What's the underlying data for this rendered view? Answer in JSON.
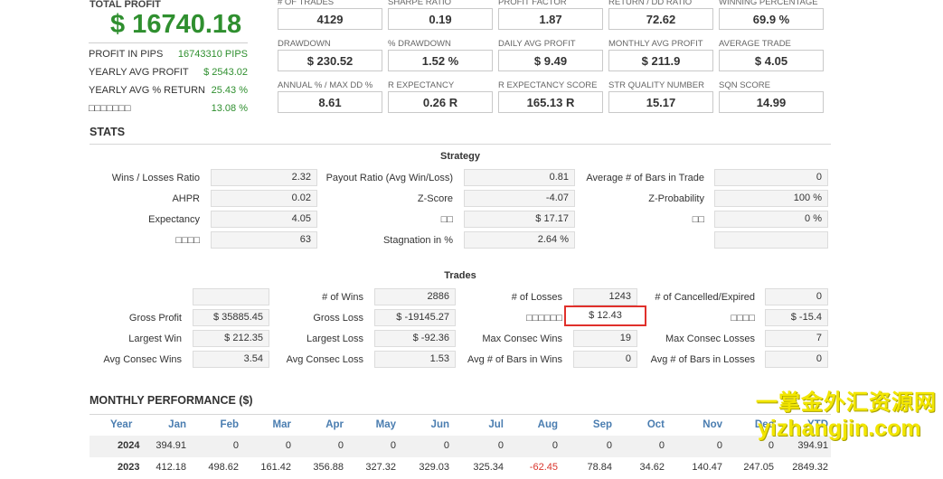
{
  "summary": {
    "total_profit_label": "TOTAL PROFIT",
    "total_profit_value": "$ 16740.18",
    "rows": [
      {
        "label": "PROFIT IN PIPS",
        "value": "16743310 PIPS"
      },
      {
        "label": "YEARLY AVG PROFIT",
        "value": "$ 2543.02"
      },
      {
        "label": "YEARLY AVG % RETURN",
        "value": "25.43 %"
      },
      {
        "label": "□□□□□□□",
        "value": "13.08 %"
      }
    ]
  },
  "metrics": [
    {
      "label": "# OF TRADES",
      "value": "4129"
    },
    {
      "label": "SHARPE RATIO",
      "value": "0.19"
    },
    {
      "label": "PROFIT FACTOR",
      "value": "1.87"
    },
    {
      "label": "RETURN / DD RATIO",
      "value": "72.62"
    },
    {
      "label": "WINNING PERCENTAGE",
      "value": "69.9 %"
    },
    {
      "label": "DRAWDOWN",
      "value": "$ 230.52"
    },
    {
      "label": "% DRAWDOWN",
      "value": "1.52 %"
    },
    {
      "label": "DAILY AVG PROFIT",
      "value": "$ 9.49"
    },
    {
      "label": "MONTHLY AVG PROFIT",
      "value": "$ 211.9"
    },
    {
      "label": "AVERAGE TRADE",
      "value": "$ 4.05"
    },
    {
      "label": "ANNUAL % / MAX DD %",
      "value": "8.61"
    },
    {
      "label": "R EXPECTANCY",
      "value": "0.26 R"
    },
    {
      "label": "R EXPECTANCY SCORE",
      "value": "165.13 R"
    },
    {
      "label": "STR QUALITY NUMBER",
      "value": "15.17"
    },
    {
      "label": "SQN SCORE",
      "value": "14.99"
    }
  ],
  "stats": {
    "title": "STATS",
    "strategy_title": "Strategy",
    "strategy_rows": [
      [
        {
          "label": "Wins / Losses Ratio",
          "value": "2.32"
        },
        {
          "label": "Payout Ratio (Avg Win/Loss)",
          "value": "0.81"
        },
        {
          "label": "Average # of Bars in Trade",
          "value": "0"
        }
      ],
      [
        {
          "label": "AHPR",
          "value": "0.02"
        },
        {
          "label": "Z-Score",
          "value": "-4.07"
        },
        {
          "label": "Z-Probability",
          "value": "100 %"
        }
      ],
      [
        {
          "label": "Expectancy",
          "value": "4.05"
        },
        {
          "label": "□□",
          "value": "$ 17.17"
        },
        {
          "label": "□□",
          "value": "0 %"
        }
      ],
      [
        {
          "label": "□□□□",
          "value": "63"
        },
        {
          "label": "Stagnation in %",
          "value": "2.64 %"
        },
        {
          "label": "",
          "value": ""
        }
      ]
    ],
    "trades_title": "Trades",
    "trades_rows": [
      [
        {
          "label": "",
          "value": ""
        },
        {
          "label": "# of Wins",
          "value": "2886"
        },
        {
          "label": "# of Losses",
          "value": "1243"
        },
        {
          "label": "# of Cancelled/Expired",
          "value": "0"
        }
      ],
      [
        {
          "label": "Gross Profit",
          "value": "$ 35885.45"
        },
        {
          "label": "Gross Loss",
          "value": "$ -19145.27"
        },
        {
          "label": "□□□□□□",
          "value": "$ 12.43"
        },
        {
          "label": "□□□□",
          "value": "$ -15.4"
        }
      ],
      [
        {
          "label": "Largest Win",
          "value": "$ 212.35"
        },
        {
          "label": "Largest Loss",
          "value": "$ -92.36"
        },
        {
          "label": "Max Consec Wins",
          "value": "19"
        },
        {
          "label": "Max Consec Losses",
          "value": "7"
        }
      ],
      [
        {
          "label": "Avg Consec Wins",
          "value": "3.54"
        },
        {
          "label": "Avg Consec Loss",
          "value": "1.53"
        },
        {
          "label": "Avg # of Bars in Wins",
          "value": "0"
        },
        {
          "label": "Avg # of Bars in Losses",
          "value": "0"
        }
      ]
    ]
  },
  "monthly": {
    "title": "MONTHLY PERFORMANCE ($)",
    "headers": [
      "Year",
      "Jan",
      "Feb",
      "Mar",
      "Apr",
      "May",
      "Jun",
      "Jul",
      "Aug",
      "Sep",
      "Oct",
      "Nov",
      "Dec",
      "YTD"
    ],
    "rows": [
      [
        "2024",
        "394.91",
        "0",
        "0",
        "0",
        "0",
        "0",
        "0",
        "0",
        "0",
        "0",
        "0",
        "0",
        "394.91"
      ],
      [
        "2023",
        "412.18",
        "498.62",
        "161.42",
        "356.88",
        "327.32",
        "329.03",
        "325.34",
        "-62.45",
        "78.84",
        "34.62",
        "140.47",
        "247.05",
        "2849.32"
      ]
    ]
  },
  "watermark": {
    "line1": "一掌金外汇资源网",
    "line2": "yizhangjin.com"
  },
  "colors": {
    "profit_green": "#2f8f2f",
    "header_blue": "#4a7db0",
    "negative_red": "#d9342b",
    "highlight_red": "#e0302b",
    "watermark_yellow": "#f2e600"
  }
}
